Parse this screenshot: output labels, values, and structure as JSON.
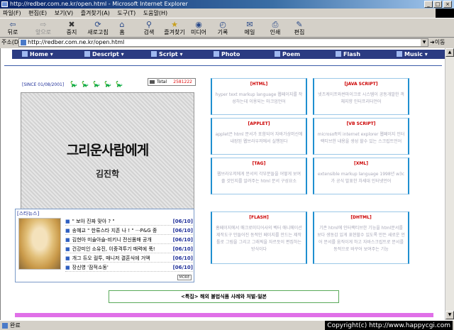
{
  "window": {
    "title": "http://redber.com.ne.kr/open.html - Microsoft Internet Explorer",
    "controls": [
      "_",
      "□",
      "×"
    ]
  },
  "menu": [
    "파일(F)",
    "편집(E)",
    "보기(V)",
    "즐겨찾기(A)",
    "도구(T)",
    "도움말(H)"
  ],
  "toolbar": [
    {
      "label": "뒤로",
      "icon": "back-arrow-icon",
      "glyph": "⇦",
      "enabled": true
    },
    {
      "label": "앞으로",
      "icon": "forward-arrow-icon",
      "glyph": "⇨",
      "enabled": false
    },
    {
      "label": "중지",
      "icon": "stop-icon",
      "glyph": "✖",
      "enabled": true
    },
    {
      "label": "새로고침",
      "icon": "refresh-icon",
      "glyph": "⟳",
      "enabled": true
    },
    {
      "label": "홈",
      "icon": "home-icon",
      "glyph": "⌂",
      "enabled": true
    },
    {
      "label": "검색",
      "icon": "search-icon",
      "glyph": "⚲",
      "enabled": true
    },
    {
      "label": "즐겨찾기",
      "icon": "favorites-icon",
      "glyph": "★",
      "enabled": true
    },
    {
      "label": "미디어",
      "icon": "media-icon",
      "glyph": "◉",
      "enabled": true
    },
    {
      "label": "기록",
      "icon": "history-icon",
      "glyph": "◴",
      "enabled": true
    },
    {
      "label": "메일",
      "icon": "mail-icon",
      "glyph": "✉",
      "enabled": true
    },
    {
      "label": "인쇄",
      "icon": "print-icon",
      "glyph": "⎙",
      "enabled": true
    },
    {
      "label": "편집",
      "icon": "edit-icon",
      "glyph": "✎",
      "enabled": true
    }
  ],
  "address": {
    "label": "주소(D)",
    "url": "http://redber.com.ne.kr/open.html",
    "go": "이동"
  },
  "site_nav": [
    {
      "label": "Home ▾",
      "icon": "home-icon"
    },
    {
      "label": "Descript ▾",
      "icon": "descript-icon"
    },
    {
      "label": "Script ▾",
      "icon": "script-icon"
    },
    {
      "label": "Photo",
      "icon": "photo-icon"
    },
    {
      "label": "Poem",
      "icon": "poem-icon"
    },
    {
      "label": "Flash",
      "icon": "flash-icon"
    },
    {
      "label": "Music ▾",
      "icon": "music-icon"
    }
  ],
  "since": "[SINCE 01/08/2001]",
  "counter": {
    "label": "Total",
    "value": "2581222"
  },
  "main_image": {
    "title": "그리운사람에게",
    "author": "김진학"
  },
  "news": {
    "header": "[스타뉴스]",
    "more": "MORE",
    "items": [
      {
        "text": "\" 보아 진짜 맞아 ? \"",
        "date": "[06/10]"
      },
      {
        "text": "송혜교 \" 한류스타 지존 나 ! \" ···P&G 중",
        "date": "[06/10]"
      },
      {
        "text": "김현아 미술아슬-비키니 전신몸매 공개",
        "date": "[06/10]"
      },
      {
        "text": "건강미인 소유진, 이중격투기 매력에 푹!",
        "date": "[06/10]"
      },
      {
        "text": "개그 듀오 컬투, 매니저 결혼식에 거액",
        "date": "[06/10]"
      },
      {
        "text": "장신영 '잠적소동'",
        "date": "[06/10]"
      }
    ]
  },
  "boxes": [
    {
      "title": "[HTML]",
      "text": "hyper text markup language 웹페이지를 작성하는데 이용되는 마크업언어"
    },
    {
      "title": "[JAVA SCRIPT]",
      "text": "넷츠케이프와썬마이크로 시스템이 공동개발한 객체지향 인터프리터언어"
    },
    {
      "title": "[APPLET]",
      "text": "applet은 html 문서가 포함되어 자바가상머신에 내장된 웹브라우저에서 실행된다"
    },
    {
      "title": "[VB SCRIPT]",
      "text": "microsoft의 internet explorer 웹페이지 인터랙티브한 내용을 생성 할수 있는 스크립트언어"
    },
    {
      "title": "[TAG]",
      "text": "웹브라우저에게 문서의 각부분들을 어떻게 보여 줄 것인지를 알려주는 html 문서 구성요소"
    },
    {
      "title": "[XML]",
      "text": "extensible markup language 1998년 w3c가 공식 발표한 차세대 인터넷언어"
    },
    {
      "title": "[FLASH]",
      "text": "홈페이지에서 매크로미디어사의 벡터 애니메이션 제작도구 만들어진 동적인 페이지를 만드는 제작툴로 그림을 그리고 그래픽을 자르듯이 편집하는 방식이다"
    },
    {
      "title": "[DHTML]",
      "text": "기존 html에 인터랙티브한 기능을 html문서를 보다 생동감 있게 표현할수 있도록 만든 새로운 언어 문서를 움직이게 하고 자바스크립트로 문서를 동적으로 바꾸어 보여주는 기능"
    }
  ],
  "feature": "<특집> 해외 불법식품 사례와 처벌-일본",
  "status": {
    "text": "완료",
    "copyright": "Copyright(c) http://www.happycgi.com"
  },
  "colors": {
    "nav_bg": "#2b3b82",
    "title_red": "#cc0000",
    "box_border": "#1f8fd0",
    "pink_bar": "#e070e8"
  }
}
